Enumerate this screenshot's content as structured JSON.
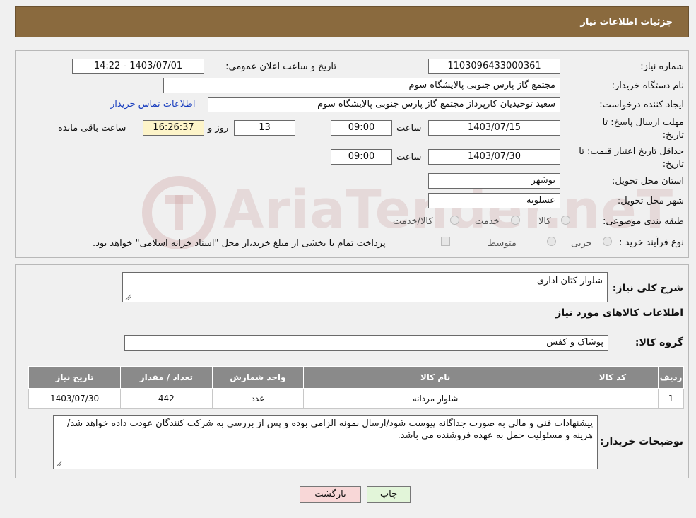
{
  "header": {
    "title": "جزئیات اطلاعات نیاز"
  },
  "details": {
    "need_number_label": "شماره نیاز:",
    "need_number": "1103096433000361",
    "announce_label": "تاریخ و ساعت اعلان عمومی:",
    "announce_value": "1403/07/01 - 14:22",
    "buyer_org_label": "نام دستگاه خریدار:",
    "buyer_org": "مجتمع گاز پارس جنوبی  پالایشگاه سوم",
    "requester_label": "ایجاد کننده درخواست:",
    "requester": "سعید توحیدیان کارپرداز مجتمع گاز پارس جنوبی  پالایشگاه سوم",
    "contact_link": "اطلاعات تماس خریدار",
    "deadline_label_1": "مهلت ارسال پاسخ: تا",
    "deadline_label_2": "تاریخ:",
    "deadline_date": "1403/07/15",
    "time_label": "ساعت",
    "deadline_time": "09:00",
    "days_value": "13",
    "days_label": "روز و",
    "remaining_time": "16:26:37",
    "remaining_label": "ساعت باقی مانده",
    "validity_label_1": "حداقل تاریخ اعتبار قیمت: تا",
    "validity_label_2": "تاریخ:",
    "validity_date": "1403/07/30",
    "validity_time": "09:00",
    "province_label": "استان محل تحویل:",
    "province": "بوشهر",
    "city_label": "شهر محل تحویل:",
    "city": "عسلویه",
    "category_label": "طبقه بندی موضوعی:",
    "category_options": [
      "کالا",
      "خدمت",
      "کالا/خدمت"
    ],
    "process_label": "نوع فرآیند خرید :",
    "process_options": [
      "جزیی",
      "متوسط"
    ],
    "process_note": "پرداخت تمام یا بخشی از مبلغ خرید،از محل \"اسناد خزانه اسلامی\" خواهد بود."
  },
  "description": {
    "label": "شرح کلی نیاز:",
    "value": "شلوار کتان اداری"
  },
  "goods": {
    "section_title": "اطلاعات کالاهای مورد نیاز",
    "group_label": "گروه کالا:",
    "group_value": "پوشاک و کفش",
    "columns": [
      "ردیف",
      "کد کالا",
      "نام کالا",
      "واحد شمارش",
      "تعداد / مقدار",
      "تاریخ نیاز"
    ],
    "rows": [
      {
        "row": "1",
        "code": "--",
        "name": "شلوار مردانه",
        "unit": "عدد",
        "qty": "442",
        "date": "1403/07/30"
      }
    ]
  },
  "buyer_notes": {
    "label": "توضیحات خریدار:",
    "value": "پیشنهادات فنی و مالی به صورت جداگانه پیوست شود/ارسال نمونه الزامی بوده و پس از بررسی به شرکت کنندگان عودت داده خواهد شد/هزینه و مسئولیت حمل به عهده فروشنده می باشد."
  },
  "buttons": {
    "print": "چاپ",
    "back": "بازگشت"
  },
  "watermark": {
    "text": "AriaTender.neT"
  },
  "colors": {
    "header": "#8a6a3e",
    "table_header": "#8a8a8a",
    "back_button": "#f8d7d7",
    "print_button": "#e2f5d9",
    "link": "#1a3fbf"
  }
}
